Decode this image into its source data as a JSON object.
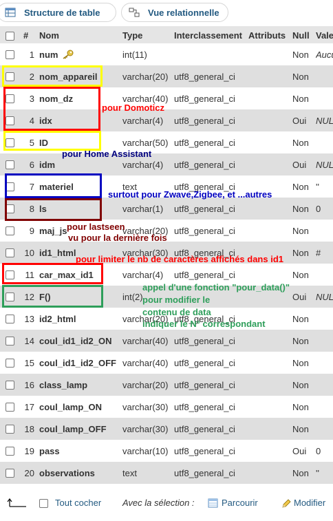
{
  "tabs": [
    {
      "label": "Structure de table",
      "icon": "table-structure-icon"
    },
    {
      "label": "Vue relationnelle",
      "icon": "relation-icon"
    }
  ],
  "columns": [
    "#",
    "Nom",
    "Type",
    "Interclassement",
    "Attributs",
    "Null",
    "Vale"
  ],
  "rows": [
    {
      "num": "1",
      "name": "num",
      "type": "int(11)",
      "coll": "",
      "null": "Non",
      "def": "Aucu",
      "def_italic": true,
      "key": true
    },
    {
      "num": "2",
      "name": "nom_appareil",
      "type": "varchar(20)",
      "coll": "utf8_general_ci",
      "null": "Non",
      "def": ""
    },
    {
      "num": "3",
      "name": "nom_dz",
      "type": "varchar(40)",
      "coll": "utf8_general_ci",
      "null": "Non",
      "def": ""
    },
    {
      "num": "4",
      "name": "idx",
      "type": "varchar(4)",
      "coll": "utf8_general_ci",
      "null": "Oui",
      "def": "NUL",
      "def_italic": true
    },
    {
      "num": "5",
      "name": "ID",
      "type": "varchar(50)",
      "coll": "utf8_general_ci",
      "null": "Non",
      "def": ""
    },
    {
      "num": "6",
      "name": "idm",
      "type": "varchar(4)",
      "coll": "utf8_general_ci",
      "null": "Oui",
      "def": "NUL",
      "def_italic": true
    },
    {
      "num": "7",
      "name": "materiel",
      "type": "text",
      "coll": "utf8_general_ci",
      "null": "Non",
      "def": "''"
    },
    {
      "num": "8",
      "name": "ls",
      "type": "varchar(1)",
      "coll": "utf8_general_ci",
      "null": "Non",
      "def": "0"
    },
    {
      "num": "9",
      "name": "maj_js",
      "type": "varchar(20)",
      "coll": "utf8_general_ci",
      "null": "Non",
      "def": ""
    },
    {
      "num": "10",
      "name": "id1_html",
      "type": "varchar(30)",
      "coll": "utf8_general_ci",
      "null": "Non",
      "def": "#"
    },
    {
      "num": "11",
      "name": "car_max_id1",
      "type": "varchar(4)",
      "coll": "utf8_general_ci",
      "null": "Non",
      "def": ""
    },
    {
      "num": "12",
      "name": "F()",
      "type": "int(2)",
      "coll": "",
      "null": "Oui",
      "def": "NUL",
      "def_italic": true
    },
    {
      "num": "13",
      "name": "id2_html",
      "type": "varchar(20)",
      "coll": "utf8_general_ci",
      "null": "Non",
      "def": ""
    },
    {
      "num": "14",
      "name": "coul_id1_id2_ON",
      "type": "varchar(40)",
      "coll": "utf8_general_ci",
      "null": "Non",
      "def": ""
    },
    {
      "num": "15",
      "name": "coul_id1_id2_OFF",
      "type": "varchar(40)",
      "coll": "utf8_general_ci",
      "null": "Non",
      "def": ""
    },
    {
      "num": "16",
      "name": "class_lamp",
      "type": "varchar(20)",
      "coll": "utf8_general_ci",
      "null": "Non",
      "def": ""
    },
    {
      "num": "17",
      "name": "coul_lamp_ON",
      "type": "varchar(30)",
      "coll": "utf8_general_ci",
      "null": "Non",
      "def": ""
    },
    {
      "num": "18",
      "name": "coul_lamp_OFF",
      "type": "varchar(30)",
      "coll": "utf8_general_ci",
      "null": "Non",
      "def": ""
    },
    {
      "num": "19",
      "name": "pass",
      "type": "varchar(10)",
      "coll": "utf8_general_ci",
      "null": "Oui",
      "def": "0"
    },
    {
      "num": "20",
      "name": "observations",
      "type": "text",
      "coll": "utf8_general_ci",
      "null": "Non",
      "def": "''"
    }
  ],
  "annotations": {
    "domoticz": "pour Domoticz",
    "home_assistant": "pour Home Assistant",
    "zwave": "surtout pour Zwave,Zigbee, et ...autres",
    "lastseen_1": "pour lastseen",
    "lastseen_2": "vu pour la dernière fois",
    "limit": "pour limiter le nb de caractères affichés dans id1",
    "func_1": "appel d'une fonction \"pour_data()\"",
    "func_2": "pour modifier le",
    "func_3": "contenu de data",
    "func_4": "indiquer le N° correspondant"
  },
  "colors": {
    "yellow": "#ffff00",
    "red": "#ff0000",
    "blue": "#0000c0",
    "darkred": "#800000",
    "green": "#2e9e5a",
    "link": "#235a81"
  },
  "bottom": {
    "check_all": "Tout cocher",
    "with_selection": "Avec la sélection :",
    "browse": "Parcourir",
    "modify": "Modifier"
  }
}
